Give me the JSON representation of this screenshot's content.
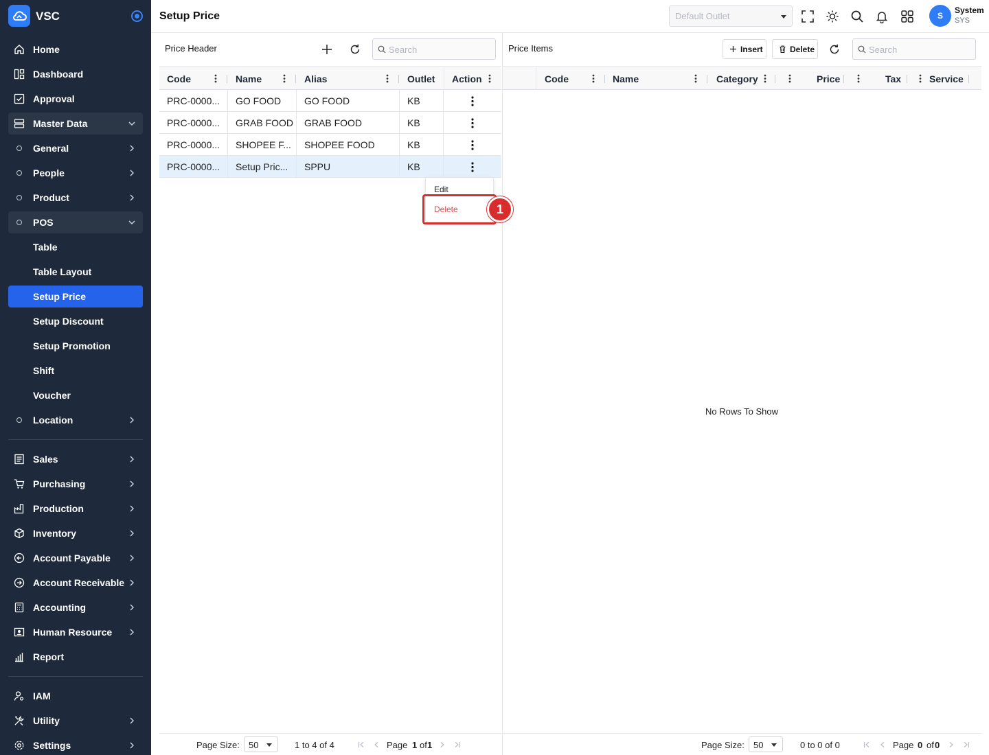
{
  "app": {
    "brand": "VSC",
    "page_title": "Setup Price"
  },
  "sidebar": {
    "home": "Home",
    "dashboard": "Dashboard",
    "approval": "Approval",
    "master_data": "Master Data",
    "general": "General",
    "people": "People",
    "product": "Product",
    "pos": "POS",
    "pos_items": [
      "Table",
      "Table Layout",
      "Setup Price",
      "Setup Discount",
      "Setup Promotion",
      "Shift",
      "Voucher"
    ],
    "location": "Location",
    "sales": "Sales",
    "purchasing": "Purchasing",
    "production": "Production",
    "inventory": "Inventory",
    "account_payable": "Account Payable",
    "account_receivable": "Account Receivable",
    "accounting": "Accounting",
    "human_resource": "Human Resource",
    "report": "Report",
    "iam": "IAM",
    "utility": "Utility",
    "settings": "Settings"
  },
  "topbar": {
    "outlet_placeholder": "Default Outlet",
    "user_initial": "S",
    "user_name": "System",
    "user_code": "SYS"
  },
  "price_header": {
    "title": "Price Header",
    "search_placeholder": "Search",
    "columns": [
      "Code",
      "Name",
      "Alias",
      "Outlet",
      "Action"
    ],
    "rows": [
      {
        "code": "PRC-0000...",
        "name": "GO FOOD",
        "alias": "GO FOOD",
        "outlet": "KB"
      },
      {
        "code": "PRC-0000...",
        "name": "GRAB FOOD",
        "alias": "GRAB FOOD",
        "outlet": "KB"
      },
      {
        "code": "PRC-0000...",
        "name": "SHOPEE F...",
        "alias": "SHOPEE FOOD",
        "outlet": "KB"
      },
      {
        "code": "PRC-0000...",
        "name": "Setup Pric...",
        "alias": "SPPU",
        "outlet": "KB"
      }
    ],
    "context_menu": {
      "edit": "Edit",
      "delete": "Delete"
    },
    "footer": {
      "page_size_label": "Page Size:",
      "page_size": "50",
      "range": "1 to 4 of 4",
      "page_word": "Page",
      "page_num": "1",
      "of_word": "of",
      "page_total": "1"
    }
  },
  "price_items": {
    "title": "Price Items",
    "insert_label": "Insert",
    "delete_label": "Delete",
    "search_placeholder": "Search",
    "columns": [
      "Code",
      "Name",
      "Category",
      "Price",
      "Tax",
      "Service"
    ],
    "empty_text": "No Rows To Show",
    "footer": {
      "page_size_label": "Page Size:",
      "page_size": "50",
      "range": "0 to 0 of 0",
      "page_word": "Page",
      "page_num": "0",
      "of_word": "of",
      "page_total": "0"
    }
  },
  "annotation": {
    "step": "1",
    "color": "#d92d2d"
  },
  "colors": {
    "sidebar_bg": "#1e2a3b",
    "accent": "#2563eb",
    "danger": "#ef4444",
    "selected_row": "#e4f0fb"
  }
}
